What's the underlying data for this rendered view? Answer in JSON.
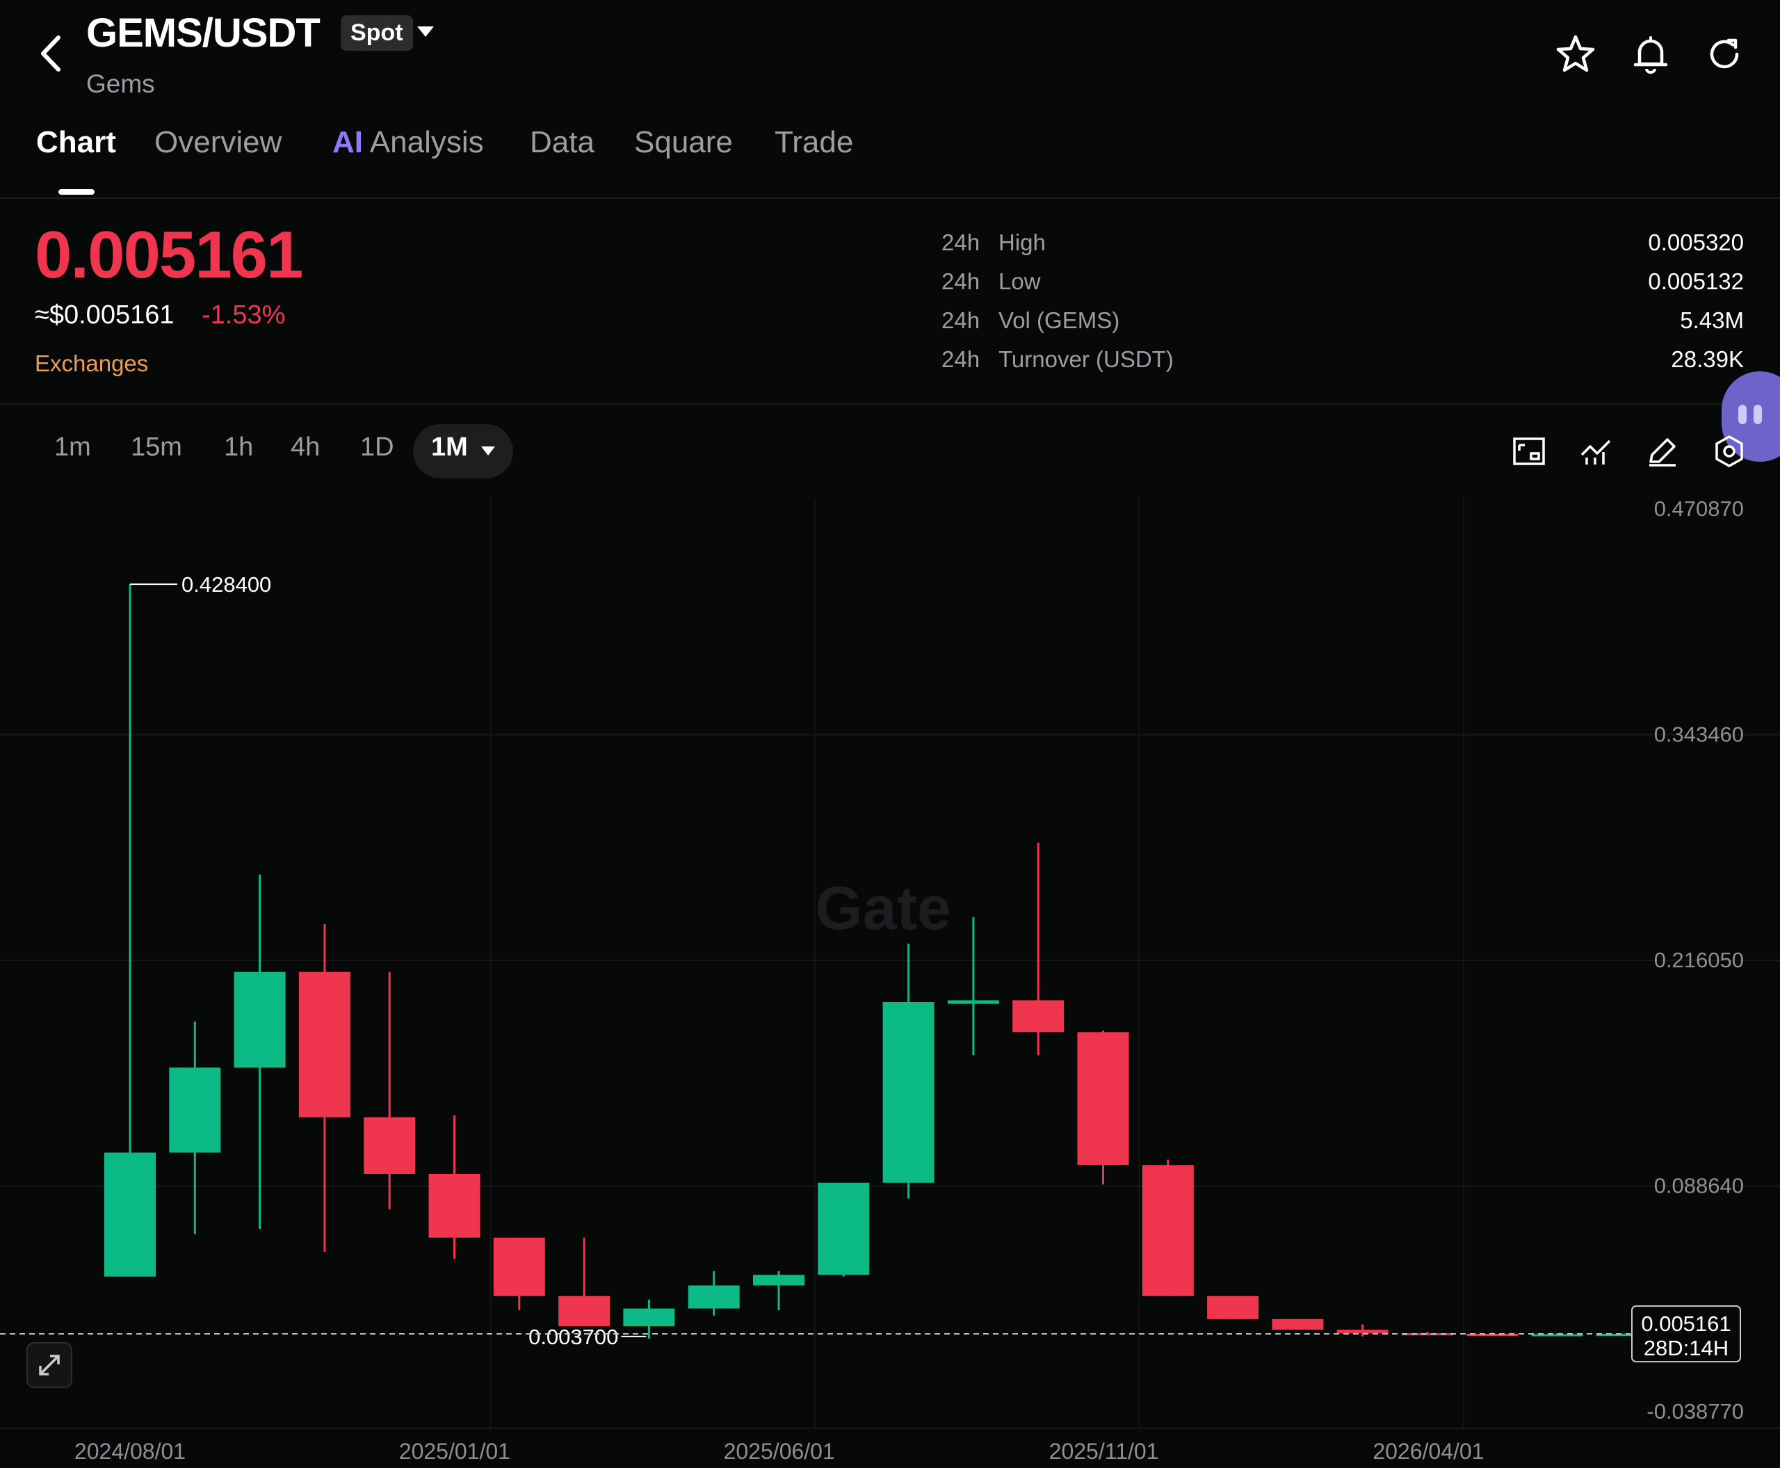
{
  "header": {
    "pair": "GEMS/USDT",
    "market_type": "Spot",
    "subtitle": "Gems",
    "icons": [
      "back-icon",
      "star-icon",
      "bell-icon",
      "refresh-icon"
    ]
  },
  "tabs": [
    {
      "label": "Chart",
      "active": true
    },
    {
      "label": "Overview"
    },
    {
      "prefix": "AI",
      "label": "Analysis"
    },
    {
      "label": "Data"
    },
    {
      "label": "Square"
    },
    {
      "label": "Trade"
    }
  ],
  "price": {
    "last": "0.005161",
    "usd": "≈$0.005161",
    "change": "-1.53%",
    "exchanges_link": "Exchanges"
  },
  "stats": [
    {
      "period": "24h",
      "label": "High",
      "value": "0.005320"
    },
    {
      "period": "24h",
      "label": "Low",
      "value": "0.005132"
    },
    {
      "period": "24h",
      "label": "Vol (GEMS)",
      "value": "5.43M"
    },
    {
      "period": "24h",
      "label": "Turnover (USDT)",
      "value": "28.39K"
    }
  ],
  "timeframes": [
    "1m",
    "15m",
    "1h",
    "4h",
    "1D"
  ],
  "selected_timeframe": "1M",
  "chart_tools": [
    "fullscreen-icon",
    "indicators-icon",
    "draw-icon",
    "settings-icon"
  ],
  "colors": {
    "up": "#0bba84",
    "down": "#f0364f",
    "accent": "#f0364f",
    "exchanges": "#ee9b55",
    "ai": "#8b7cf6"
  },
  "chart_data": {
    "type": "candlestick",
    "interval": "1M",
    "watermark": "Gate",
    "y_ticks": [
      "0.470870",
      "0.343460",
      "0.216050",
      "0.088640",
      "-0.038770"
    ],
    "ylim": [
      -0.03877,
      0.47087
    ],
    "x_ticks": [
      "2024/08/01",
      "2025/01/01",
      "2025/06/01",
      "2025/11/01",
      "2026/04/01"
    ],
    "x_tick_index": [
      0,
      5,
      10,
      15,
      20
    ],
    "max_label": "0.428400",
    "min_label": "0.003700",
    "last_price_label": "0.005161",
    "countdown": "28D:14H",
    "candles": [
      {
        "o": 0.0375,
        "h": 0.4284,
        "l": 0.0375,
        "c": 0.1075
      },
      {
        "o": 0.1075,
        "h": 0.1815,
        "l": 0.0615,
        "c": 0.1555
      },
      {
        "o": 0.1555,
        "h": 0.2645,
        "l": 0.0645,
        "c": 0.2095
      },
      {
        "o": 0.2095,
        "h": 0.2365,
        "l": 0.0515,
        "c": 0.1275
      },
      {
        "o": 0.1275,
        "h": 0.2095,
        "l": 0.0755,
        "c": 0.0955
      },
      {
        "o": 0.0955,
        "h": 0.1285,
        "l": 0.0475,
        "c": 0.0595
      },
      {
        "o": 0.0595,
        "h": 0.0595,
        "l": 0.0185,
        "c": 0.0265
      },
      {
        "o": 0.0265,
        "h": 0.0595,
        "l": 0.0095,
        "c": 0.0095
      },
      {
        "o": 0.0095,
        "h": 0.0245,
        "l": 0.0025,
        "c": 0.0195
      },
      {
        "o": 0.0195,
        "h": 0.0405,
        "l": 0.0155,
        "c": 0.0325
      },
      {
        "o": 0.0325,
        "h": 0.0405,
        "l": 0.0185,
        "c": 0.0385
      },
      {
        "o": 0.0385,
        "h": 0.0785,
        "l": 0.0375,
        "c": 0.0905
      },
      {
        "o": 0.0905,
        "h": 0.2255,
        "l": 0.0815,
        "c": 0.1925
      },
      {
        "o": 0.1915,
        "h": 0.2405,
        "l": 0.1625,
        "c": 0.1935
      },
      {
        "o": 0.1935,
        "h": 0.2825,
        "l": 0.1625,
        "c": 0.1755
      },
      {
        "o": 0.1755,
        "h": 0.1765,
        "l": 0.0895,
        "c": 0.1005
      },
      {
        "o": 0.1005,
        "h": 0.1035,
        "l": 0.0265,
        "c": 0.0265
      },
      {
        "o": 0.0265,
        "h": 0.0265,
        "l": 0.0135,
        "c": 0.0135
      },
      {
        "o": 0.0135,
        "h": 0.0135,
        "l": 0.0075,
        "c": 0.0075
      },
      {
        "o": 0.0075,
        "h": 0.0105,
        "l": 0.0037,
        "c": 0.0055
      },
      {
        "o": 0.0055,
        "h": 0.0062,
        "l": 0.0048,
        "c": 0.0052
      },
      {
        "o": 0.0052,
        "h": 0.0058,
        "l": 0.0045,
        "c": 0.005
      },
      {
        "o": 0.005,
        "h": 0.0055,
        "l": 0.0046,
        "c": 0.005
      },
      {
        "o": 0.005,
        "h": 0.0053,
        "l": 0.0049,
        "c": 0.005161
      }
    ]
  }
}
